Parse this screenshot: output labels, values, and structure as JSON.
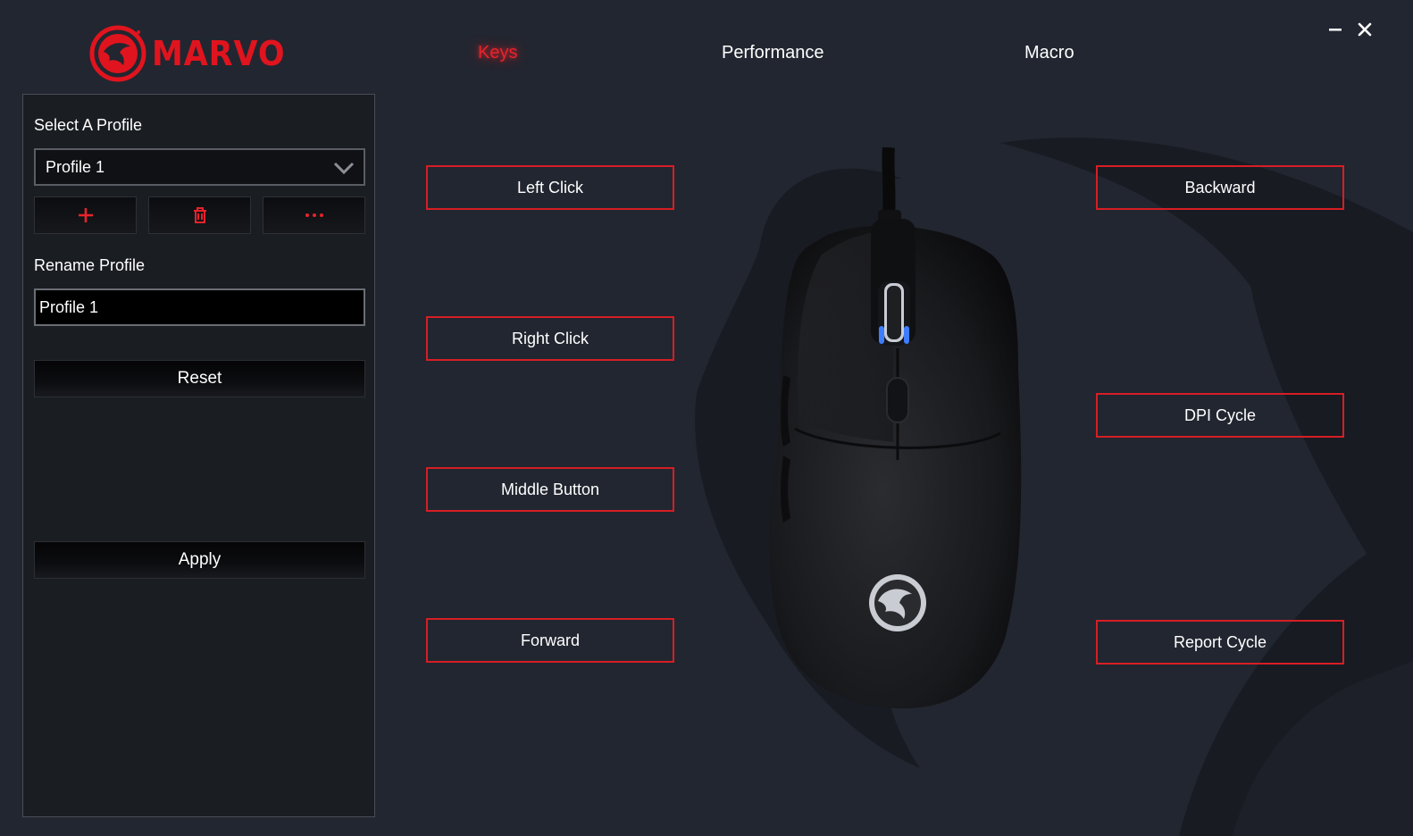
{
  "brand": {
    "name": "MARVO",
    "accent": "#e0141e"
  },
  "tabs": [
    {
      "label": "Keys",
      "active": true
    },
    {
      "label": "Performance",
      "active": false
    },
    {
      "label": "Macro",
      "active": false
    }
  ],
  "window_controls": {
    "minimize": "minimize-icon",
    "close": "close-icon"
  },
  "sidebar": {
    "select_label": "Select A Profile",
    "selected_profile": "Profile 1",
    "icons": [
      "plus-icon",
      "trash-icon",
      "more-icon"
    ],
    "rename_label": "Rename Profile",
    "rename_value": "Profile 1",
    "reset_label": "Reset",
    "apply_label": "Apply"
  },
  "keys": {
    "left_click": "Left Click",
    "right_click": "Right Click",
    "middle_button": "Middle Button",
    "forward": "Forward",
    "backward": "Backward",
    "dpi_cycle": "DPI Cycle",
    "report_cycle": "Report Cycle"
  },
  "colors": {
    "background": "#222630",
    "panel": "#1a1d22",
    "button_border": "#d61e25",
    "active_tab": "#e8232b"
  }
}
